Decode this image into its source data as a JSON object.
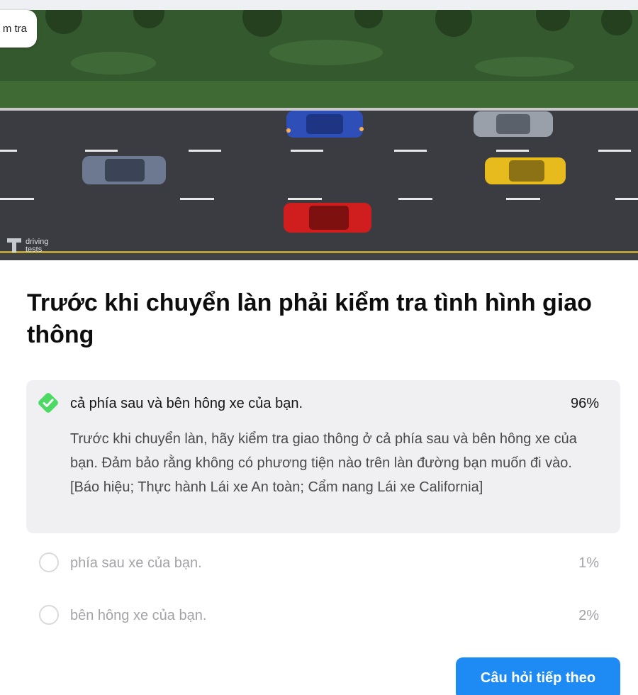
{
  "header": {
    "tag_label": "m tra"
  },
  "scene": {
    "watermark_line1": "driving",
    "watermark_line2": "tests"
  },
  "question": {
    "text": "Trước khi chuyển làn phải kiểm tra tình hình giao thông"
  },
  "answers": [
    {
      "text": "cả phía sau và bên hông xe của bạn.",
      "percent": "96%",
      "correct": true,
      "explanation": "Trước khi chuyển làn, hãy kiểm tra giao thông ở cả phía sau và bên hông xe của bạn. Đảm bảo rằng không có phương tiện nào trên làn đường bạn muốn đi vào. [Báo hiệu; Thực hành Lái xe An toàn; Cẩm nang Lái xe California]"
    },
    {
      "text": "phía sau xe của bạn.",
      "percent": "1%",
      "correct": false
    },
    {
      "text": "bên hông xe của bạn.",
      "percent": "2%",
      "correct": false
    }
  ],
  "next_button": {
    "label": "Câu hỏi tiếp theo"
  },
  "colors": {
    "correct_green": "#4cd964",
    "button_blue": "#1e8bf5",
    "muted_text": "#a3a3a8"
  },
  "icons": {
    "correct": "check-diamond-icon",
    "option": "radio-circle-icon"
  }
}
